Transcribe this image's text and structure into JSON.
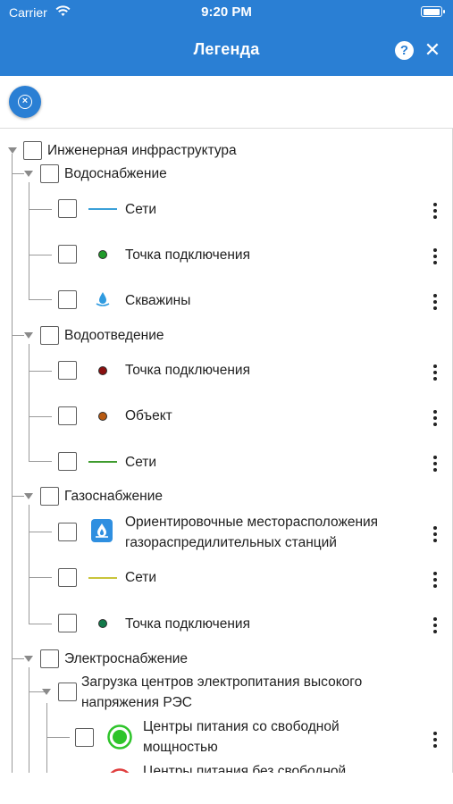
{
  "status_bar": {
    "carrier": "Carrier",
    "time": "9:20 PM"
  },
  "header": {
    "title": "Легенда",
    "help_label": "?",
    "close_label": "✕"
  },
  "toolbar": {
    "clear_icon": "x-circle-icon"
  },
  "tree": {
    "root": {
      "label": "Инженерная инфраструктура"
    },
    "water": {
      "label": "Водоснабжение",
      "items": [
        {
          "label": "Сети",
          "color": "#3aa0d8",
          "icon": "line-symbol"
        },
        {
          "label": "Точка подключения",
          "color": "#1f9a2a",
          "icon": "dot-symbol"
        },
        {
          "label": "Скважины",
          "color": "#2f9be0",
          "icon": "water-drop-icon"
        }
      ]
    },
    "sewer": {
      "label": "Водоотведение",
      "items": [
        {
          "label": "Точка подключения",
          "color": "#8a1010",
          "icon": "dot-symbol"
        },
        {
          "label": "Объект",
          "color": "#b85a12",
          "icon": "dot-symbol"
        },
        {
          "label": "Сети",
          "color": "#3f9c2e",
          "icon": "line-symbol"
        }
      ]
    },
    "gas": {
      "label": "Газоснабжение",
      "items": [
        {
          "label": "Ориентировочные месторасположения газораспредилительных станций",
          "color": "#2f8fe0",
          "icon": "gas-station-icon"
        },
        {
          "label": "Сети",
          "color": "#c9c43a",
          "icon": "line-symbol"
        },
        {
          "label": "Точка подключения",
          "color": "#127a4a",
          "icon": "dot-symbol"
        }
      ]
    },
    "power": {
      "label": "Электроснабжение",
      "sub": {
        "label": "Загрузка центров электропитания высокого напряжения РЭС",
        "items": [
          {
            "label": "Центры питания со свободной мощностью",
            "color": "#2ec42a",
            "icon": "power-center-icon"
          },
          {
            "label": "Центры питания без свободной",
            "color": "#e04040",
            "icon": "power-center-icon"
          }
        ]
      }
    }
  }
}
